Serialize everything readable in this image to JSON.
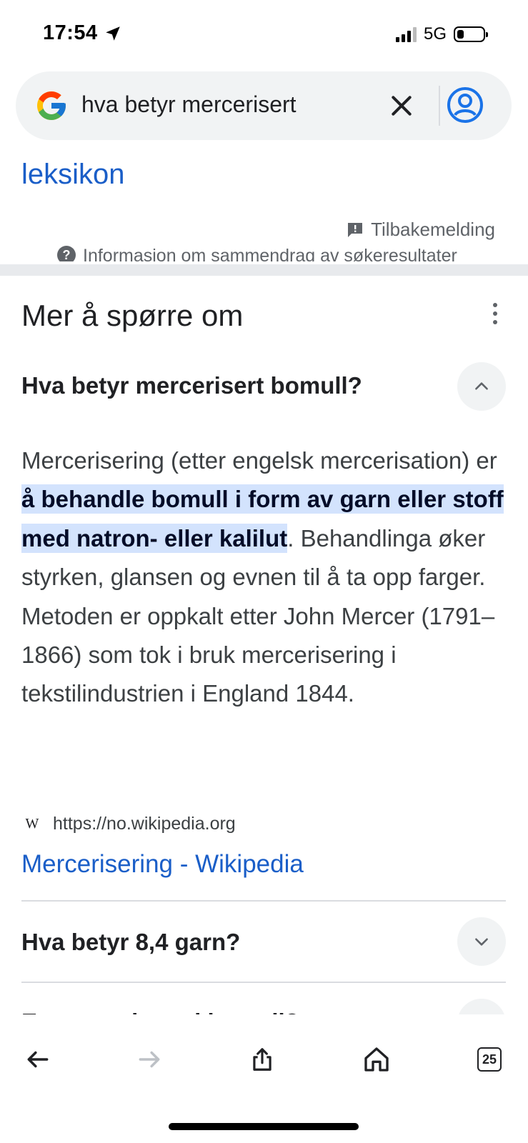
{
  "status_bar": {
    "time": "17:54",
    "network": "5G",
    "battery_level": 0.25
  },
  "search": {
    "query": "hva betyr mercerisert"
  },
  "previous_result": {
    "link_text": "leksikon",
    "feedback_label": "Tilbakemelding",
    "summary_info": "Informasjon om sammendrag av søkeresultater"
  },
  "paa": {
    "title": "Mer å spørre om",
    "q1": {
      "question": "Hva betyr mercerisert bomull?",
      "expanded": true,
      "answer_before": "Mercerisering (etter engelsk mercerisation) er ",
      "answer_highlight": "å behandle bomull i form av garn eller stoff med natron- eller kalilut",
      "answer_after": ". Behandlinga øker styrken, glansen og evnen til å ta opp farger. Metoden er oppkalt etter John Mercer (1791–1866) som tok i bruk mercerisering i tekstilindustrien i England 1844.",
      "source_url": "https://no.wikipedia.org",
      "source_title": "Mercerisering - Wikipedia",
      "favicon_letter": "W"
    },
    "q2": {
      "question": "Hva betyr 8,4 garn?",
      "expanded": false
    },
    "q3": {
      "question": "Er merceriserad bomull?",
      "expanded": false
    }
  },
  "toolbar": {
    "tab_count": "25"
  },
  "colors": {
    "link": "#1a5ec8",
    "highlight": "#d3e3fd",
    "chip_bg": "#f1f3f4"
  },
  "icons": [
    "location-arrow-icon",
    "signal-icon",
    "battery-icon",
    "google-logo-icon",
    "close-icon",
    "account-icon",
    "feedback-icon",
    "help-icon",
    "more-vert-icon",
    "chevron-up-icon",
    "chevron-down-icon",
    "back-arrow-icon",
    "forward-arrow-icon",
    "share-icon",
    "home-icon",
    "tabs-icon"
  ]
}
